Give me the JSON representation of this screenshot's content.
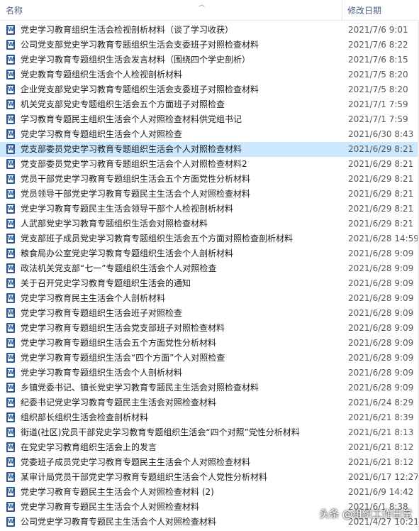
{
  "header": {
    "name_label": "名称",
    "date_label": "修改日期",
    "sort_icon": "chevron-up-icon"
  },
  "files": [
    {
      "name": "党史学习教育组织生活会检视剖析材料（谈了学习收获）",
      "date": "2021/7/6 9:01"
    },
    {
      "name": "公司党支部党史学习教育专题组织生活会支委班子对照检查材料",
      "date": "2021/7/6 8:22"
    },
    {
      "name": "党史学习教育专题组织生活会发言材料（围绕四个学史剖析）",
      "date": "2021/7/6 8:15"
    },
    {
      "name": "党史教育专题组织生活会个人检视剖析材料",
      "date": "2021/7/5 8:20"
    },
    {
      "name": "企业党支部党史学习教育专题组织生活会支委班子对照检查材料",
      "date": "2021/7/5 8:20"
    },
    {
      "name": "机关党支部党史专题组织生活会五个方面班子对照检查",
      "date": "2021/7/1 7:59"
    },
    {
      "name": "学习教育专题民主组织生活会个人对照检查材料供党组书记",
      "date": "2021/7/1 7:59"
    },
    {
      "name": "党史学习教育专题组织生活会个人对照检查",
      "date": "2021/6/30 8:43"
    },
    {
      "name": "党支部委员党史学习教育专题组织生活会个人对照检查材料",
      "date": "2021/6/29 8:21",
      "selected": true
    },
    {
      "name": "党支部委员党史学习教育专题组织生活会个人对照检查材料2",
      "date": "2021/6/29 8:21"
    },
    {
      "name": "党员干部党史学习教育专题组织生活会五个方面党性分析材料",
      "date": "2021/6/29 8:21"
    },
    {
      "name": "党员领导干部党史学习教育专题民主生活会个人对照检查材料",
      "date": "2021/6/29 8:21"
    },
    {
      "name": "党史学习教育专题民主生活会领导干部个人检视剖析材料",
      "date": "2021/6/29 8:21"
    },
    {
      "name": "人武部党史学习教育专题组织生活会对照检查材料",
      "date": "2021/6/29 8:21"
    },
    {
      "name": "党支部班子成员党史学习教育专题组织生活会五个方面对照检查剖析材料",
      "date": "2021/6/28 14:59"
    },
    {
      "name": "粮食局办公室党史学习教育专题组织生活会个人剖析材料",
      "date": "2021/6/28 9:09"
    },
    {
      "name": "政法机关党支部“七一”专题组织生活会个人对照检查",
      "date": "2021/6/28 9:09"
    },
    {
      "name": "关于召开党史学习教育专题组织生活会的通知",
      "date": "2021/6/28 9:09"
    },
    {
      "name": "党史学习教育民主生活会个人剖析材料",
      "date": "2021/6/28 9:09"
    },
    {
      "name": "党史学习教育专题组织生活会班子对照检查",
      "date": "2021/6/28 9:09"
    },
    {
      "name": "党史学习教育专题组织生活会党支部班子对照检查材料",
      "date": "2021/6/28 9:09"
    },
    {
      "name": "党史学习教育专题组织生活会五个方面党性分析材料",
      "date": "2021/6/28 9:09"
    },
    {
      "name": "党史学习教育专题组织生活会“四个方面”个人对照检查",
      "date": "2021/6/28 9:09"
    },
    {
      "name": "党史学习教育专题组织生活会个人剖析材料",
      "date": "2021/6/28 9:09"
    },
    {
      "name": "乡镇党委书记、镇长党史学习教育专题民主生活会对照检查材料",
      "date": "2021/6/28 9:09"
    },
    {
      "name": "纪委书记党史学习教育专题民主生活会对照检查材料",
      "date": "2021/6/24 8:29"
    },
    {
      "name": "组织部长组织生活会检查剖析材料",
      "date": "2021/6/21 8:39"
    },
    {
      "name": "街道(社区)党员干部党史学习教育专题组织生活会“四个对照”党性分析材料",
      "date": "2021/6/21 8:13"
    },
    {
      "name": "在党史学习教育组织生活会上的发言",
      "date": "2021/6/21 8:12"
    },
    {
      "name": "党委班子成员党史学习教育专题民主生活会个人对照检查材料",
      "date": "2021/6/21 8:12"
    },
    {
      "name": "某审计局党员干部党史学习教育专题组织生活会个人党性分析材料",
      "date": "2021/6/17 12:27"
    },
    {
      "name": "党史学习教育专题民主生活会个人对照检查材料 (2)",
      "date": "2021/6/9 14:42"
    },
    {
      "name": "党史学习教育专题民主生活会个人对照检查材料",
      "date": "2021/6/1 8:38"
    },
    {
      "name": "公司党史学习教育专题民主生活会个人对照检查材料",
      "date": "2021/4/27 10:21"
    }
  ],
  "watermark": "头条 @组织工作日常",
  "icons": {
    "file": "word-document-icon"
  },
  "colors": {
    "selected_row": "#cce8ff",
    "header_text": "#4d6082",
    "doc_icon": "#2b5797"
  }
}
